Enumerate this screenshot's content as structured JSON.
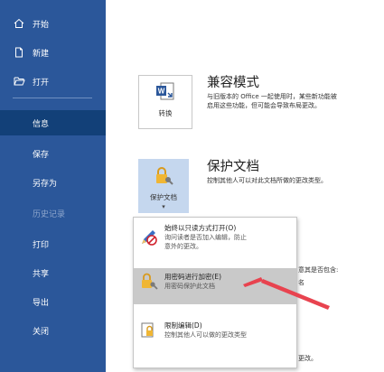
{
  "sidebar": {
    "items": [
      {
        "label": "开始"
      },
      {
        "label": "新建"
      },
      {
        "label": "打开"
      },
      {
        "label": "信息"
      },
      {
        "label": "保存"
      },
      {
        "label": "另存为"
      },
      {
        "label": "历史记录"
      },
      {
        "label": "打印"
      },
      {
        "label": "共享"
      },
      {
        "label": "导出"
      },
      {
        "label": "关闭"
      }
    ]
  },
  "compat": {
    "tile_label": "转换",
    "title": "兼容模式",
    "desc_line1": "与旧版本的 Office 一起使用时，某些新功能被",
    "desc_line2": "启用这些功能，但可能会导致布局更改。"
  },
  "protect": {
    "tile_label": "保护文档",
    "chevron": "▾",
    "title": "保护文档",
    "desc": "控制其他人可以对此文档所做的更改类型。"
  },
  "menu": {
    "items": [
      {
        "title": "始终以只读方式打开(O)",
        "desc_line1": "询问读者是否加入编辑，防止",
        "desc_line2": "意外的更改。"
      },
      {
        "title": "用密码进行加密(E)",
        "desc_line1": "用密码保护此文档",
        "desc_line2": ""
      },
      {
        "title": "限制编辑(D)",
        "desc_line1": "控制其他人可以做的更改类型",
        "desc_line2": ""
      }
    ]
  },
  "behind_text": {
    "line1": "意其是否包含:",
    "line2": "名",
    "line3": "更改。"
  },
  "colors": {
    "sidebar": "#2b579a",
    "sidebar_active": "#124078",
    "tile_highlight": "#c5d7ee",
    "menu_highlight": "#c9c9c9",
    "arrow": "#e8434f"
  }
}
